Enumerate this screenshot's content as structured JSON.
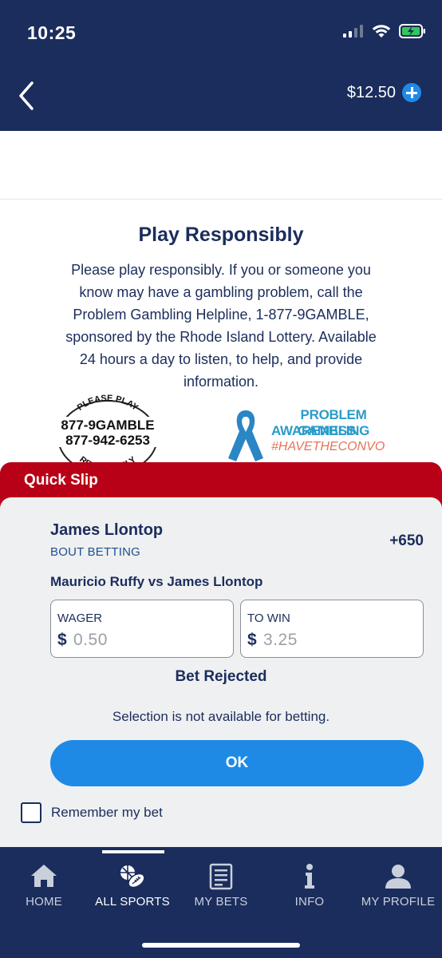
{
  "status_bar": {
    "time": "10:25"
  },
  "nav": {
    "balance": "$12.50"
  },
  "responsible": {
    "title": "Play Responsibly",
    "body": "Please play responsibly. If you or someone you know may have a gambling problem, call the Problem Gambling Helpline, 1-877-9GAMBLE, sponsored by the Rhode Island Lottery. Available 24 hours a day to listen, to help, and provide information.",
    "logo1": {
      "top": "PLEASE PLAY",
      "line1": "877-9GAMBLE",
      "line2": "877-942-6253",
      "bottom": "RESPONSIBLY"
    },
    "logo2": {
      "line1": "PROBLEM GAMBLING",
      "line2": "AWARENESS",
      "line3": "#HAVETHECONVO"
    }
  },
  "quick_slip": {
    "title": "Quick Slip",
    "selection": "James Llontop",
    "market": "BOUT BETTING",
    "odds": "+650",
    "event": "Mauricio Ruffy vs James Llontop",
    "wager": {
      "label": "WAGER",
      "currency": "$",
      "value": "0.50"
    },
    "to_win": {
      "label": "TO WIN",
      "currency": "$",
      "value": "3.25"
    },
    "status_title": "Bet Rejected",
    "status_message": "Selection is not available for betting.",
    "ok_label": "OK",
    "remember_label": "Remember my bet",
    "remember_checked": false
  },
  "tabs": [
    {
      "label": "HOME",
      "icon": "home-icon",
      "active": false
    },
    {
      "label": "ALL SPORTS",
      "icon": "sports-balls-icon",
      "active": true
    },
    {
      "label": "MY BETS",
      "icon": "bet-slip-icon",
      "active": false
    },
    {
      "label": "INFO",
      "icon": "info-icon",
      "active": false
    },
    {
      "label": "MY PROFILE",
      "icon": "profile-icon",
      "active": false
    }
  ],
  "colors": {
    "navy": "#1b2d5c",
    "accent_blue": "#1f8ae6",
    "slip_red": "#b80016"
  }
}
